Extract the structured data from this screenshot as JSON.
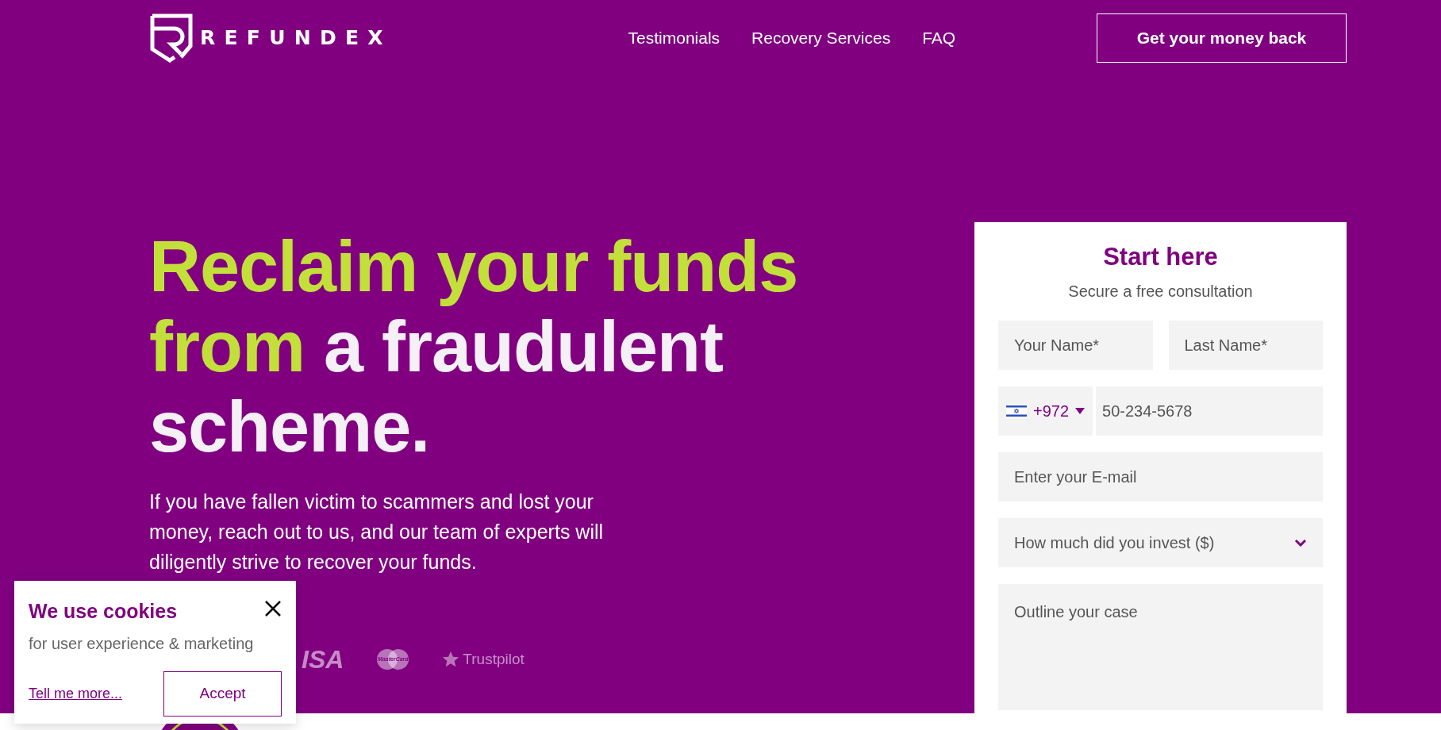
{
  "brand": {
    "name": "REFUNDEX"
  },
  "nav": {
    "links": [
      "Testimonials",
      "Recovery Services",
      "FAQ"
    ],
    "cta": "Get your money back"
  },
  "hero": {
    "headline": [
      {
        "text": "Reclaim your funds from",
        "highlight": true
      },
      {
        "text": " a fraudulent scheme.",
        "highlight": false
      }
    ],
    "description": "If you have fallen victim to scammers and lost your money, reach out to us, and our team of experts will diligently strive to recover your funds.",
    "trust_logos": [
      {
        "kind": "visa",
        "text": "ISA"
      },
      {
        "kind": "mastercard",
        "text": "MasterCard"
      },
      {
        "kind": "trustpilot",
        "text": "Trustpilot"
      }
    ]
  },
  "form": {
    "title": "Start here",
    "subtitle": "Secure a free consultation",
    "rows": [
      [
        {
          "kind": "text",
          "placeholder": "Your Name*"
        },
        {
          "kind": "text",
          "placeholder": "Last Name*"
        }
      ],
      [
        {
          "kind": "phone",
          "country_code": "+972",
          "placeholder": "50-234-5678"
        }
      ],
      [
        {
          "kind": "text",
          "placeholder": "Enter your E-mail"
        }
      ],
      [
        {
          "kind": "select",
          "placeholder": "How much did you invest ($)"
        }
      ],
      [
        {
          "kind": "textarea",
          "placeholder": "Outline your case"
        }
      ]
    ]
  },
  "cookie": {
    "title": "We use cookies",
    "text": "for user experience & marketing",
    "link": "Tell me more...",
    "accept": "Accept"
  }
}
